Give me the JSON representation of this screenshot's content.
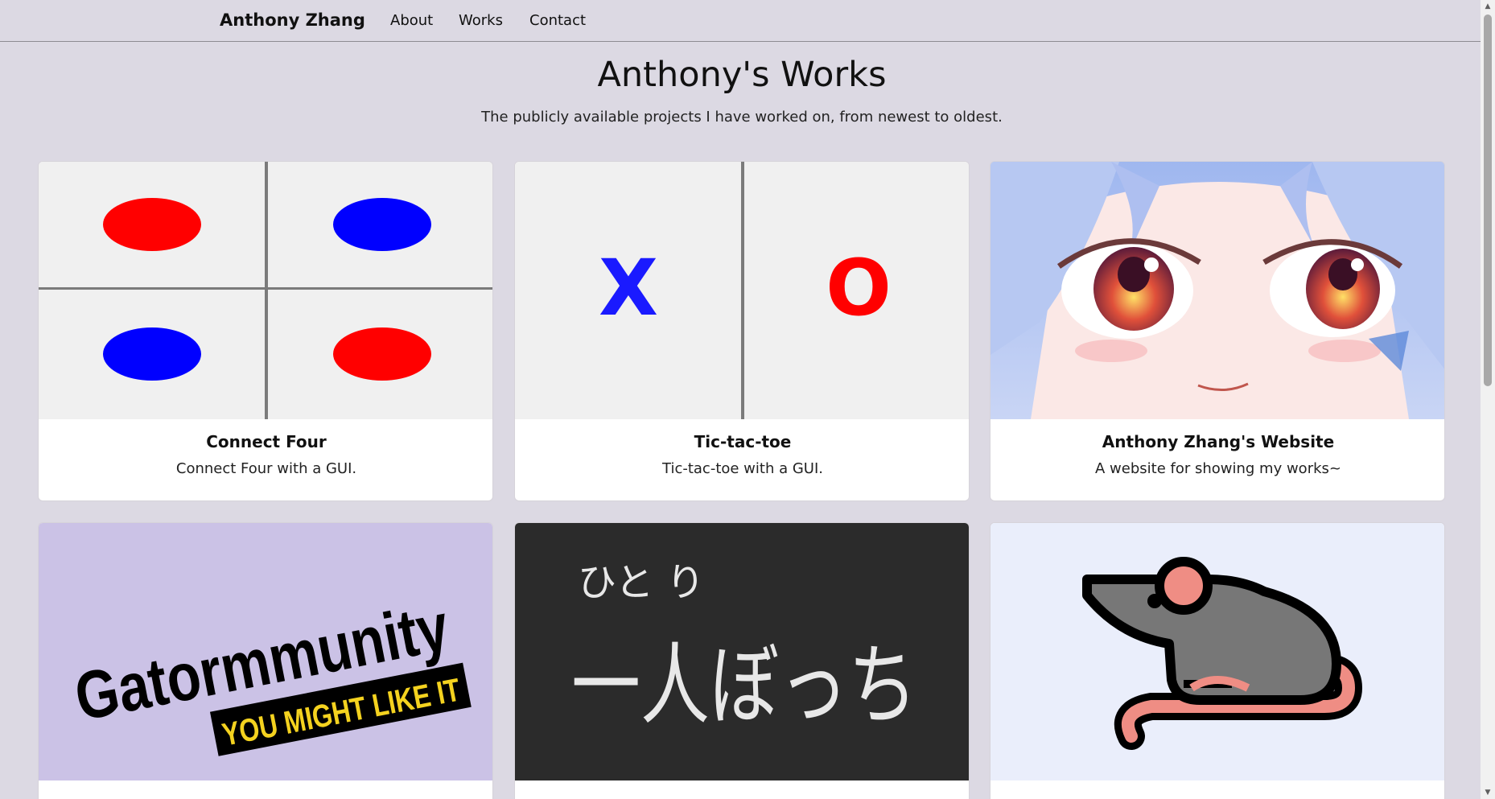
{
  "nav": {
    "brand": "Anthony Zhang",
    "links": [
      "About",
      "Works",
      "Contact"
    ]
  },
  "header": {
    "title": "Anthony's Works",
    "subtitle": "The publicly available projects I have worked on, from newest to oldest."
  },
  "cards": [
    {
      "title": "Connect Four",
      "text": "Connect Four with a GUI."
    },
    {
      "title": "Tic-tac-toe",
      "text": "Tic-tac-toe with a GUI.",
      "image_text": {
        "x": "X",
        "o": "O"
      }
    },
    {
      "title": "Anthony Zhang's Website",
      "text": "A website for showing my works~"
    },
    {
      "title": "",
      "text": "",
      "image_text": {
        "main": "Gatormmunity",
        "banner": "YOU MIGHT LIKE IT"
      }
    },
    {
      "title": "",
      "text": "",
      "image_text": {
        "ruby": "ひと り",
        "main": "一人ぼっち"
      }
    },
    {
      "title": "",
      "text": ""
    }
  ],
  "colors": {
    "background": "#dcd9e3",
    "connect_four_red": "#ff0000",
    "connect_four_blue": "#0000ff",
    "gatormmunity_bg": "#cbc2e6",
    "gatormmunity_banner": "#f4d21f",
    "hitoribocchi_bg": "#2b2b2b",
    "rat_bg": "#eaeefb"
  },
  "icons": {
    "anime_face": "anime-face-icon",
    "rat": "rat-icon"
  }
}
